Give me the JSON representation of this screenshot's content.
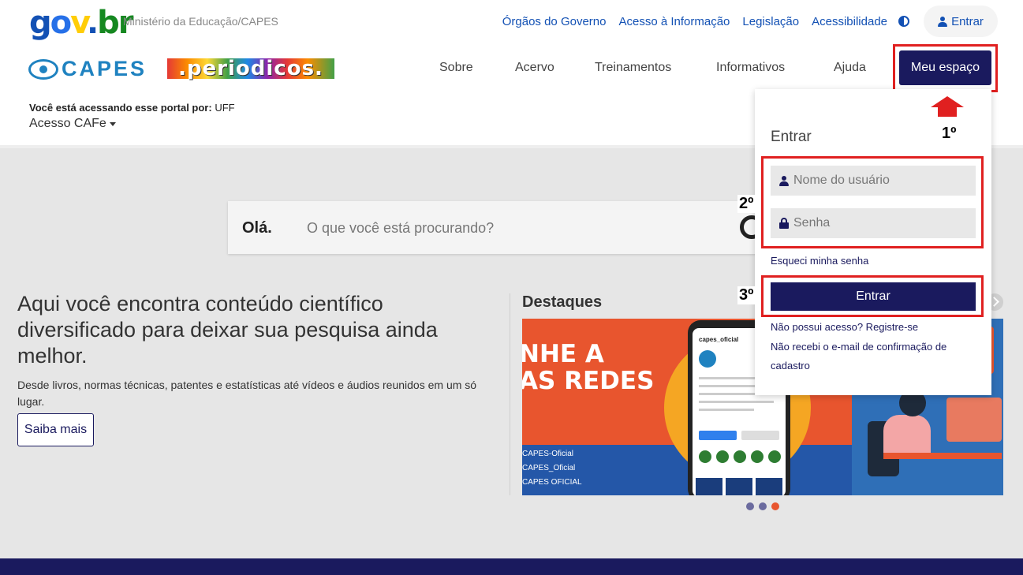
{
  "govbar": {
    "logo": {
      "g1": "g",
      "g2": "o",
      "g3": "v",
      "dot": ".",
      "g4": "br"
    },
    "ministry": "Ministério da Educação/CAPES",
    "links": [
      "Órgãos do Governo",
      "Acesso à Informação",
      "Legislação",
      "Acessibilidade"
    ],
    "contrast_icon": "contrast-icon",
    "login_label": "Entrar"
  },
  "header": {
    "capes_logo": "CAPES",
    "periodicos_logo": ".periodicos.",
    "nav": [
      "Sobre",
      "Acervo",
      "Treinamentos",
      "Informativos",
      "Ajuda"
    ],
    "meu_espaco": "Meu espaço",
    "access_label": "Você está acessando esse portal por:",
    "access_value": "UFF",
    "access_cafe": "Acesso CAFe"
  },
  "search": {
    "greeting": "Olá.",
    "placeholder": "O que você está procurando?"
  },
  "hero": {
    "title": "Aqui você encontra conteúdo científico diversificado para deixar sua pesquisa ainda melhor.",
    "subtitle": "Desde livros, normas técnicas, patentes e estatísticas até vídeos e áudios reunidos em um só lugar.",
    "button": "Saiba mais"
  },
  "highlights": {
    "title": "Destaques",
    "slide1_big": "NHE A",
    "slide1_big2": "AS REDES",
    "slide1_lines": [
      "CAPES-Oficial",
      "CAPES_Oficial",
      "CAPES OFICIAL"
    ],
    "phone_title": "capes_oficial",
    "dots": 3,
    "active_dot": 3
  },
  "login": {
    "title": "Entrar",
    "username_placeholder": "Nome do usuário",
    "password_placeholder": "Senha",
    "forgot": "Esqueci minha senha",
    "submit": "Entrar",
    "no_access": "Não possui acesso? Registre-se",
    "no_email": "Não recebi o e-mail de confirmação de cadastro"
  },
  "annotations": {
    "step1": "1º",
    "step2": "2º",
    "step3": "3º",
    "highlight_color": "#e02020"
  },
  "colors": {
    "primary": "#1a1a5e",
    "gov_blue": "#1351b4",
    "accent": "#e8552e"
  }
}
